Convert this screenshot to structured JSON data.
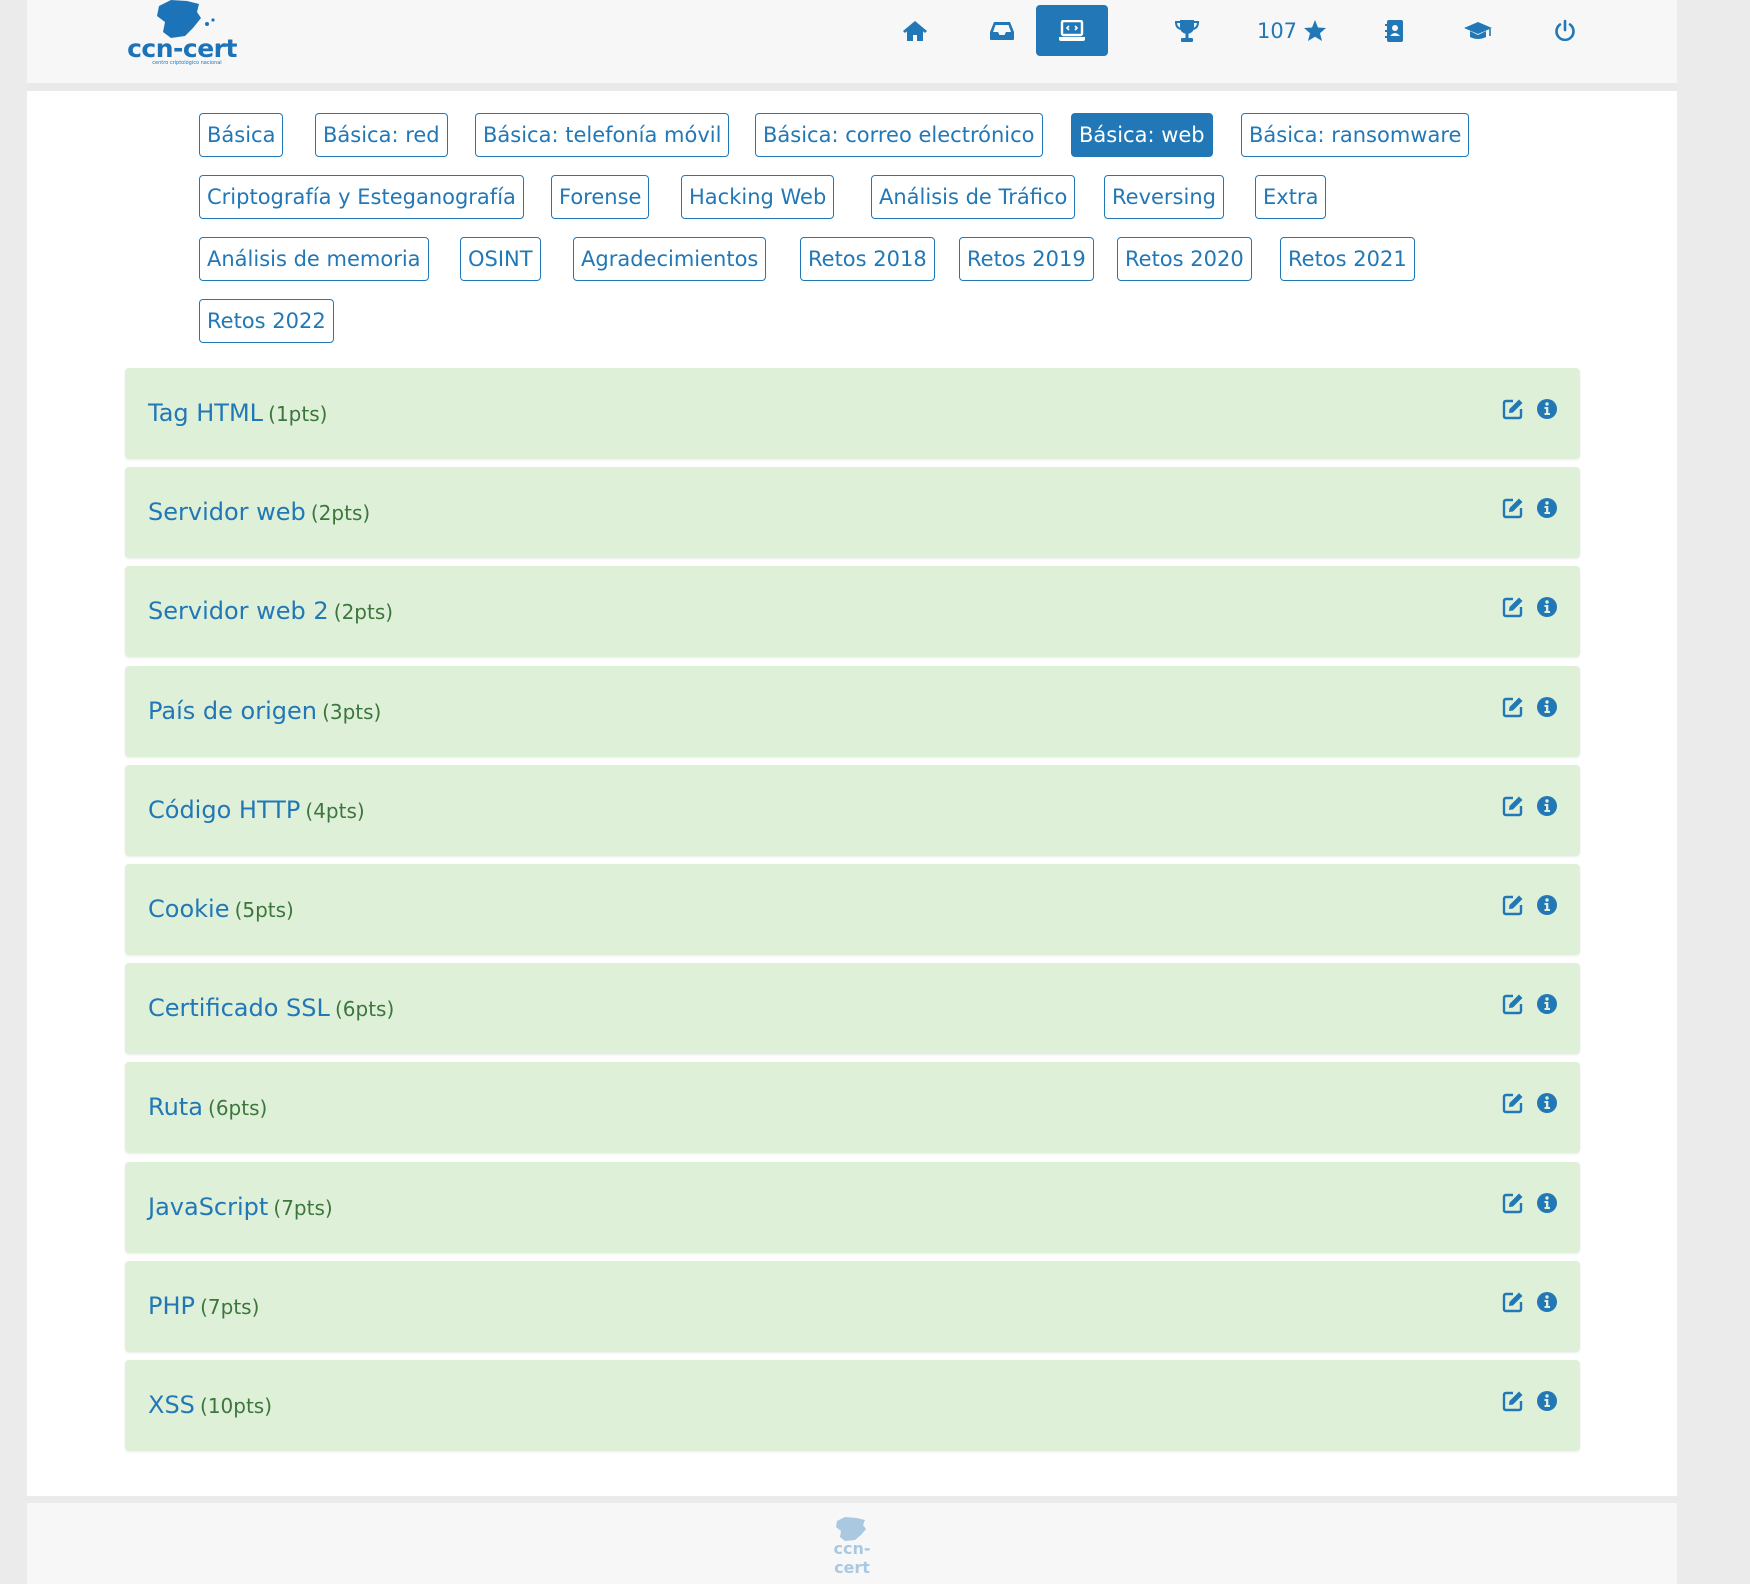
{
  "brand": {
    "logo_text": "ccn-cert",
    "logo_subtitle": "centro criptológico nacional"
  },
  "nav": {
    "items": [
      {
        "icon": "home-icon"
      },
      {
        "icon": "inbox-icon"
      },
      {
        "icon": "laptop-icon",
        "active": true
      },
      {
        "icon": "trophy-icon"
      },
      {
        "icon": "star-icon",
        "label": "107"
      },
      {
        "icon": "contact-book-icon"
      },
      {
        "icon": "graduation-cap-icon"
      },
      {
        "icon": "power-icon"
      }
    ]
  },
  "categories": [
    "Básica",
    "Básica: red",
    "Básica: telefonía móvil",
    "Básica: correo electrónico",
    "Básica: web",
    "Básica: ransomware",
    "Criptografía y Esteganografía",
    "Forense",
    "Hacking Web",
    "Análisis de Tráfico",
    "Reversing",
    "Extra",
    "Análisis de memoria",
    "OSINT",
    "Agradecimientos",
    "Retos 2018",
    "Retos 2019",
    "Retos 2020",
    "Retos 2021",
    "Retos 2022"
  ],
  "active_category": "Básica: web",
  "challenges": [
    {
      "name": "Tag HTML",
      "points": "(1pts)"
    },
    {
      "name": "Servidor web",
      "points": "(2pts)"
    },
    {
      "name": "Servidor web 2",
      "points": "(2pts)"
    },
    {
      "name": "País de origen",
      "points": "(3pts)"
    },
    {
      "name": "Código HTTP",
      "points": "(4pts)"
    },
    {
      "name": "Cookie",
      "points": "(5pts)"
    },
    {
      "name": "Certificado SSL",
      "points": "(6pts)"
    },
    {
      "name": "Ruta",
      "points": "(6pts)"
    },
    {
      "name": "JavaScript",
      "points": "(7pts)"
    },
    {
      "name": "PHP",
      "points": "(7pts)"
    },
    {
      "name": "XSS",
      "points": "(10pts)"
    }
  ],
  "colors": {
    "accent": "#2278b6",
    "solved_row": "#dff0d8",
    "points_text": "#3c763d"
  }
}
